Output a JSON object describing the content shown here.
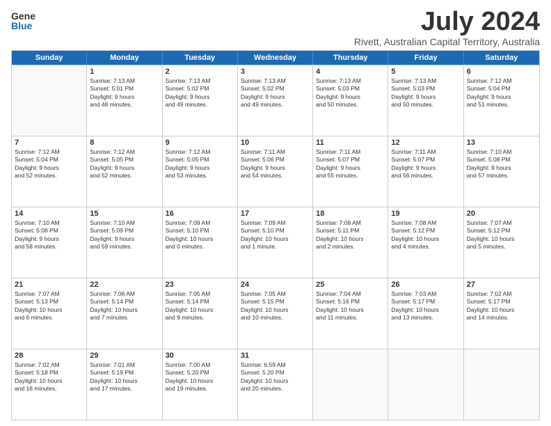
{
  "logo": {
    "line1": "General",
    "line2": "Blue"
  },
  "title": "July 2024",
  "location": "Rivett, Australian Capital Territory, Australia",
  "weekdays": [
    "Sunday",
    "Monday",
    "Tuesday",
    "Wednesday",
    "Thursday",
    "Friday",
    "Saturday"
  ],
  "rows": [
    [
      {
        "day": "",
        "empty": true,
        "lines": []
      },
      {
        "day": "1",
        "lines": [
          "Sunrise: 7:13 AM",
          "Sunset: 5:01 PM",
          "Daylight: 9 hours",
          "and 48 minutes."
        ]
      },
      {
        "day": "2",
        "lines": [
          "Sunrise: 7:13 AM",
          "Sunset: 5:02 PM",
          "Daylight: 9 hours",
          "and 49 minutes."
        ]
      },
      {
        "day": "3",
        "lines": [
          "Sunrise: 7:13 AM",
          "Sunset: 5:02 PM",
          "Daylight: 9 hours",
          "and 49 minutes."
        ]
      },
      {
        "day": "4",
        "lines": [
          "Sunrise: 7:13 AM",
          "Sunset: 5:03 PM",
          "Daylight: 9 hours",
          "and 50 minutes."
        ]
      },
      {
        "day": "5",
        "lines": [
          "Sunrise: 7:13 AM",
          "Sunset: 5:03 PM",
          "Daylight: 9 hours",
          "and 50 minutes."
        ]
      },
      {
        "day": "6",
        "lines": [
          "Sunrise: 7:12 AM",
          "Sunset: 5:04 PM",
          "Daylight: 9 hours",
          "and 51 minutes."
        ]
      }
    ],
    [
      {
        "day": "7",
        "lines": [
          "Sunrise: 7:12 AM",
          "Sunset: 5:04 PM",
          "Daylight: 9 hours",
          "and 52 minutes."
        ]
      },
      {
        "day": "8",
        "lines": [
          "Sunrise: 7:12 AM",
          "Sunset: 5:05 PM",
          "Daylight: 9 hours",
          "and 52 minutes."
        ]
      },
      {
        "day": "9",
        "lines": [
          "Sunrise: 7:12 AM",
          "Sunset: 5:05 PM",
          "Daylight: 9 hours",
          "and 53 minutes."
        ]
      },
      {
        "day": "10",
        "lines": [
          "Sunrise: 7:11 AM",
          "Sunset: 5:06 PM",
          "Daylight: 9 hours",
          "and 54 minutes."
        ]
      },
      {
        "day": "11",
        "lines": [
          "Sunrise: 7:11 AM",
          "Sunset: 5:07 PM",
          "Daylight: 9 hours",
          "and 55 minutes."
        ]
      },
      {
        "day": "12",
        "lines": [
          "Sunrise: 7:11 AM",
          "Sunset: 5:07 PM",
          "Daylight: 9 hours",
          "and 56 minutes."
        ]
      },
      {
        "day": "13",
        "lines": [
          "Sunrise: 7:10 AM",
          "Sunset: 5:08 PM",
          "Daylight: 9 hours",
          "and 57 minutes."
        ]
      }
    ],
    [
      {
        "day": "14",
        "lines": [
          "Sunrise: 7:10 AM",
          "Sunset: 5:08 PM",
          "Daylight: 9 hours",
          "and 58 minutes."
        ]
      },
      {
        "day": "15",
        "lines": [
          "Sunrise: 7:10 AM",
          "Sunset: 5:09 PM",
          "Daylight: 9 hours",
          "and 59 minutes."
        ]
      },
      {
        "day": "16",
        "lines": [
          "Sunrise: 7:09 AM",
          "Sunset: 5:10 PM",
          "Daylight: 10 hours",
          "and 0 minutes."
        ]
      },
      {
        "day": "17",
        "lines": [
          "Sunrise: 7:09 AM",
          "Sunset: 5:10 PM",
          "Daylight: 10 hours",
          "and 1 minute."
        ]
      },
      {
        "day": "18",
        "lines": [
          "Sunrise: 7:08 AM",
          "Sunset: 5:11 PM",
          "Daylight: 10 hours",
          "and 2 minutes."
        ]
      },
      {
        "day": "19",
        "lines": [
          "Sunrise: 7:08 AM",
          "Sunset: 5:12 PM",
          "Daylight: 10 hours",
          "and 4 minutes."
        ]
      },
      {
        "day": "20",
        "lines": [
          "Sunrise: 7:07 AM",
          "Sunset: 5:12 PM",
          "Daylight: 10 hours",
          "and 5 minutes."
        ]
      }
    ],
    [
      {
        "day": "21",
        "lines": [
          "Sunrise: 7:07 AM",
          "Sunset: 5:13 PM",
          "Daylight: 10 hours",
          "and 6 minutes."
        ]
      },
      {
        "day": "22",
        "lines": [
          "Sunrise: 7:06 AM",
          "Sunset: 5:14 PM",
          "Daylight: 10 hours",
          "and 7 minutes."
        ]
      },
      {
        "day": "23",
        "lines": [
          "Sunrise: 7:05 AM",
          "Sunset: 5:14 PM",
          "Daylight: 10 hours",
          "and 9 minutes."
        ]
      },
      {
        "day": "24",
        "lines": [
          "Sunrise: 7:05 AM",
          "Sunset: 5:15 PM",
          "Daylight: 10 hours",
          "and 10 minutes."
        ]
      },
      {
        "day": "25",
        "lines": [
          "Sunrise: 7:04 AM",
          "Sunset: 5:16 PM",
          "Daylight: 10 hours",
          "and 11 minutes."
        ]
      },
      {
        "day": "26",
        "lines": [
          "Sunrise: 7:03 AM",
          "Sunset: 5:17 PM",
          "Daylight: 10 hours",
          "and 13 minutes."
        ]
      },
      {
        "day": "27",
        "lines": [
          "Sunrise: 7:02 AM",
          "Sunset: 5:17 PM",
          "Daylight: 10 hours",
          "and 14 minutes."
        ]
      }
    ],
    [
      {
        "day": "28",
        "lines": [
          "Sunrise: 7:02 AM",
          "Sunset: 5:18 PM",
          "Daylight: 10 hours",
          "and 16 minutes."
        ]
      },
      {
        "day": "29",
        "lines": [
          "Sunrise: 7:01 AM",
          "Sunset: 5:19 PM",
          "Daylight: 10 hours",
          "and 17 minutes."
        ]
      },
      {
        "day": "30",
        "lines": [
          "Sunrise: 7:00 AM",
          "Sunset: 5:20 PM",
          "Daylight: 10 hours",
          "and 19 minutes."
        ]
      },
      {
        "day": "31",
        "lines": [
          "Sunrise: 6:59 AM",
          "Sunset: 5:20 PM",
          "Daylight: 10 hours",
          "and 20 minutes."
        ]
      },
      {
        "day": "",
        "empty": true,
        "lines": []
      },
      {
        "day": "",
        "empty": true,
        "lines": []
      },
      {
        "day": "",
        "empty": true,
        "lines": []
      }
    ]
  ]
}
